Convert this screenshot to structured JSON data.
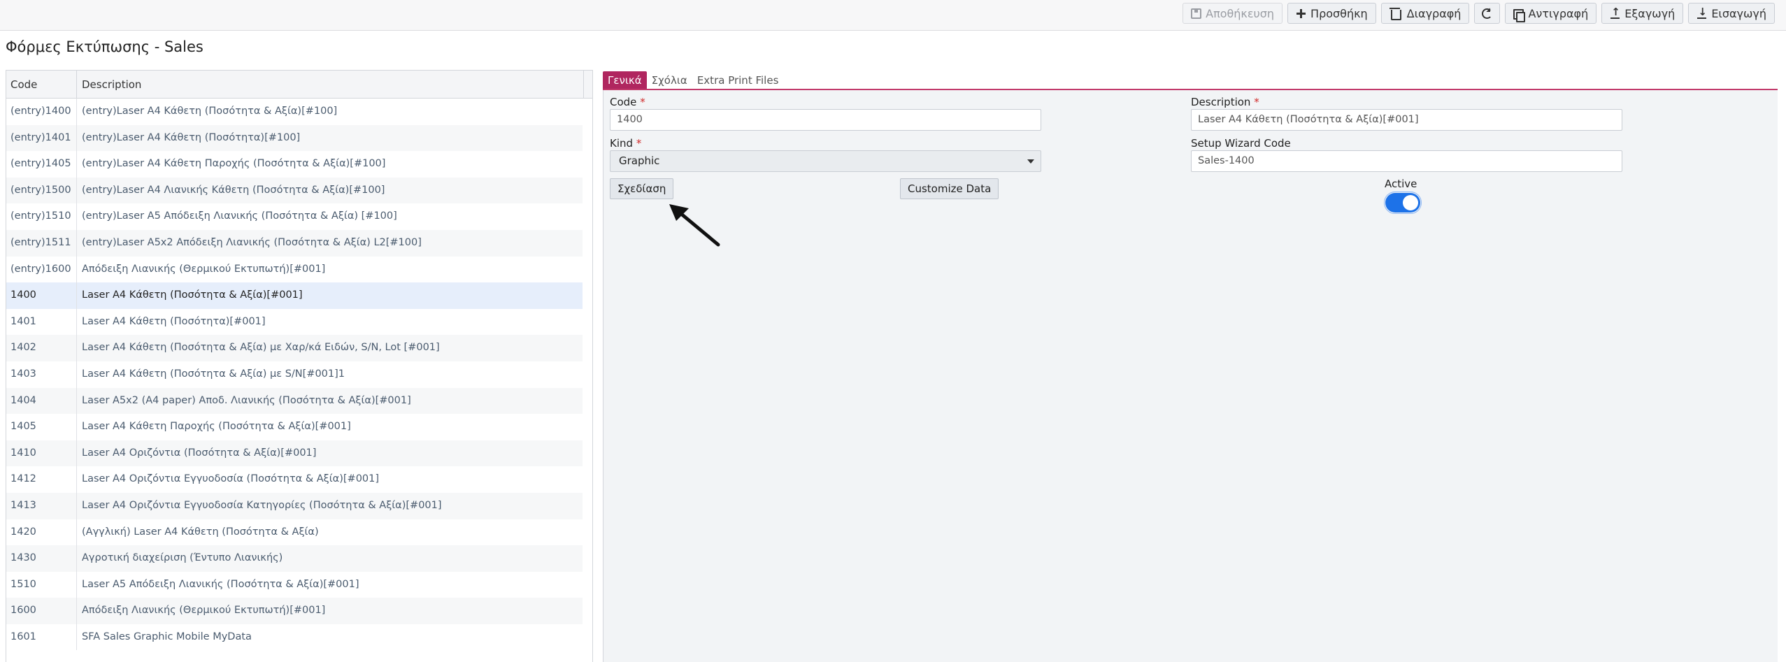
{
  "toolbar": {
    "save_label": "Αποθήκευση",
    "add_label": "Προσθήκη",
    "delete_label": "Διαγραφή",
    "copy_label": "Αντιγραφή",
    "export_label": "Εξαγωγή",
    "import_label": "Εισαγωγή"
  },
  "page": {
    "title": "Φόρμες Εκτύπωσης - Sales"
  },
  "grid": {
    "columns": [
      "Code",
      "Description"
    ],
    "rows": [
      {
        "code": "(entry)1400",
        "description": "(entry)Laser A4 Κάθετη (Ποσότητα & Αξία)[#100]"
      },
      {
        "code": "(entry)1401",
        "description": "(entry)Laser A4 Κάθετη (Ποσότητα)[#100]"
      },
      {
        "code": "(entry)1405",
        "description": "(entry)Laser A4 Κάθετη Παροχής (Ποσότητα & Αξία)[#100]"
      },
      {
        "code": "(entry)1500",
        "description": "(entry)Laser A4 Λιανικής Κάθετη (Ποσότητα & Αξία)[#100]"
      },
      {
        "code": "(entry)1510",
        "description": "(entry)Laser A5 Απόδειξη Λιανικής (Ποσότητα & Αξία) [#100]"
      },
      {
        "code": "(entry)1511",
        "description": "(entry)Laser A5x2 Απόδειξη Λιανικής (Ποσότητα & Αξία) L2[#100]"
      },
      {
        "code": "(entry)1600",
        "description": "Απόδειξη Λιανικής (Θερμικού Εκτυπωτή)[#001]"
      },
      {
        "code": "1400",
        "description": "Laser A4 Κάθετη (Ποσότητα & Αξία)[#001]"
      },
      {
        "code": "1401",
        "description": "Laser A4 Κάθετη (Ποσότητα)[#001]"
      },
      {
        "code": "1402",
        "description": "Laser A4 Κάθετη (Ποσότητα & Αξία) με Χαρ/κά Ειδών, S/N, Lot [#001]"
      },
      {
        "code": "1403",
        "description": "Laser A4 Κάθετη (Ποσότητα & Αξία) με S/N[#001]1"
      },
      {
        "code": "1404",
        "description": "Laser A5x2 (A4 paper) Αποδ. Λιανικής (Ποσότητα & Αξία)[#001]"
      },
      {
        "code": "1405",
        "description": "Laser A4 Κάθετη Παροχής (Ποσότητα & Αξία)[#001]"
      },
      {
        "code": "1410",
        "description": "Laser A4 Οριζόντια (Ποσότητα & Αξία)[#001]"
      },
      {
        "code": "1412",
        "description": "Laser A4 Οριζόντια Εγγυοδοσία (Ποσότητα & Αξία)[#001]"
      },
      {
        "code": "1413",
        "description": "Laser A4 Οριζόντια Εγγυοδοσία Κατηγορίες (Ποσότητα & Αξία)[#001]"
      },
      {
        "code": "1420",
        "description": "(Αγγλική) Laser A4 Κάθετη (Ποσότητα & Αξία)"
      },
      {
        "code": "1430",
        "description": "Αγροτική διαχείριση (Έντυπο Λιανικής)"
      },
      {
        "code": "1510",
        "description": "Laser A5 Απόδειξη Λιανικής (Ποσότητα & Αξία)[#001]"
      },
      {
        "code": "1600",
        "description": "Απόδειξη Λιανικής (Θερμικού Εκτυπωτή)[#001]"
      },
      {
        "code": "1601",
        "description": "SFA Sales Graphic Mobile MyData"
      }
    ],
    "selected_index": 7
  },
  "tabs": [
    "Γενικά",
    "Σχόλια",
    "Extra Print Files"
  ],
  "form": {
    "code_label": "Code",
    "code_value": "1400",
    "description_label": "Description",
    "description_value": "Laser A4 Κάθετη (Ποσότητα & Αξία)[#001]",
    "kind_label": "Kind",
    "kind_value": "Graphic",
    "wizard_label": "Setup Wizard Code",
    "wizard_value": "Sales-1400",
    "design_button": "Σχεδίαση",
    "customize_button": "Customize Data",
    "active_label": "Active",
    "active": true,
    "required_mark": "*"
  }
}
